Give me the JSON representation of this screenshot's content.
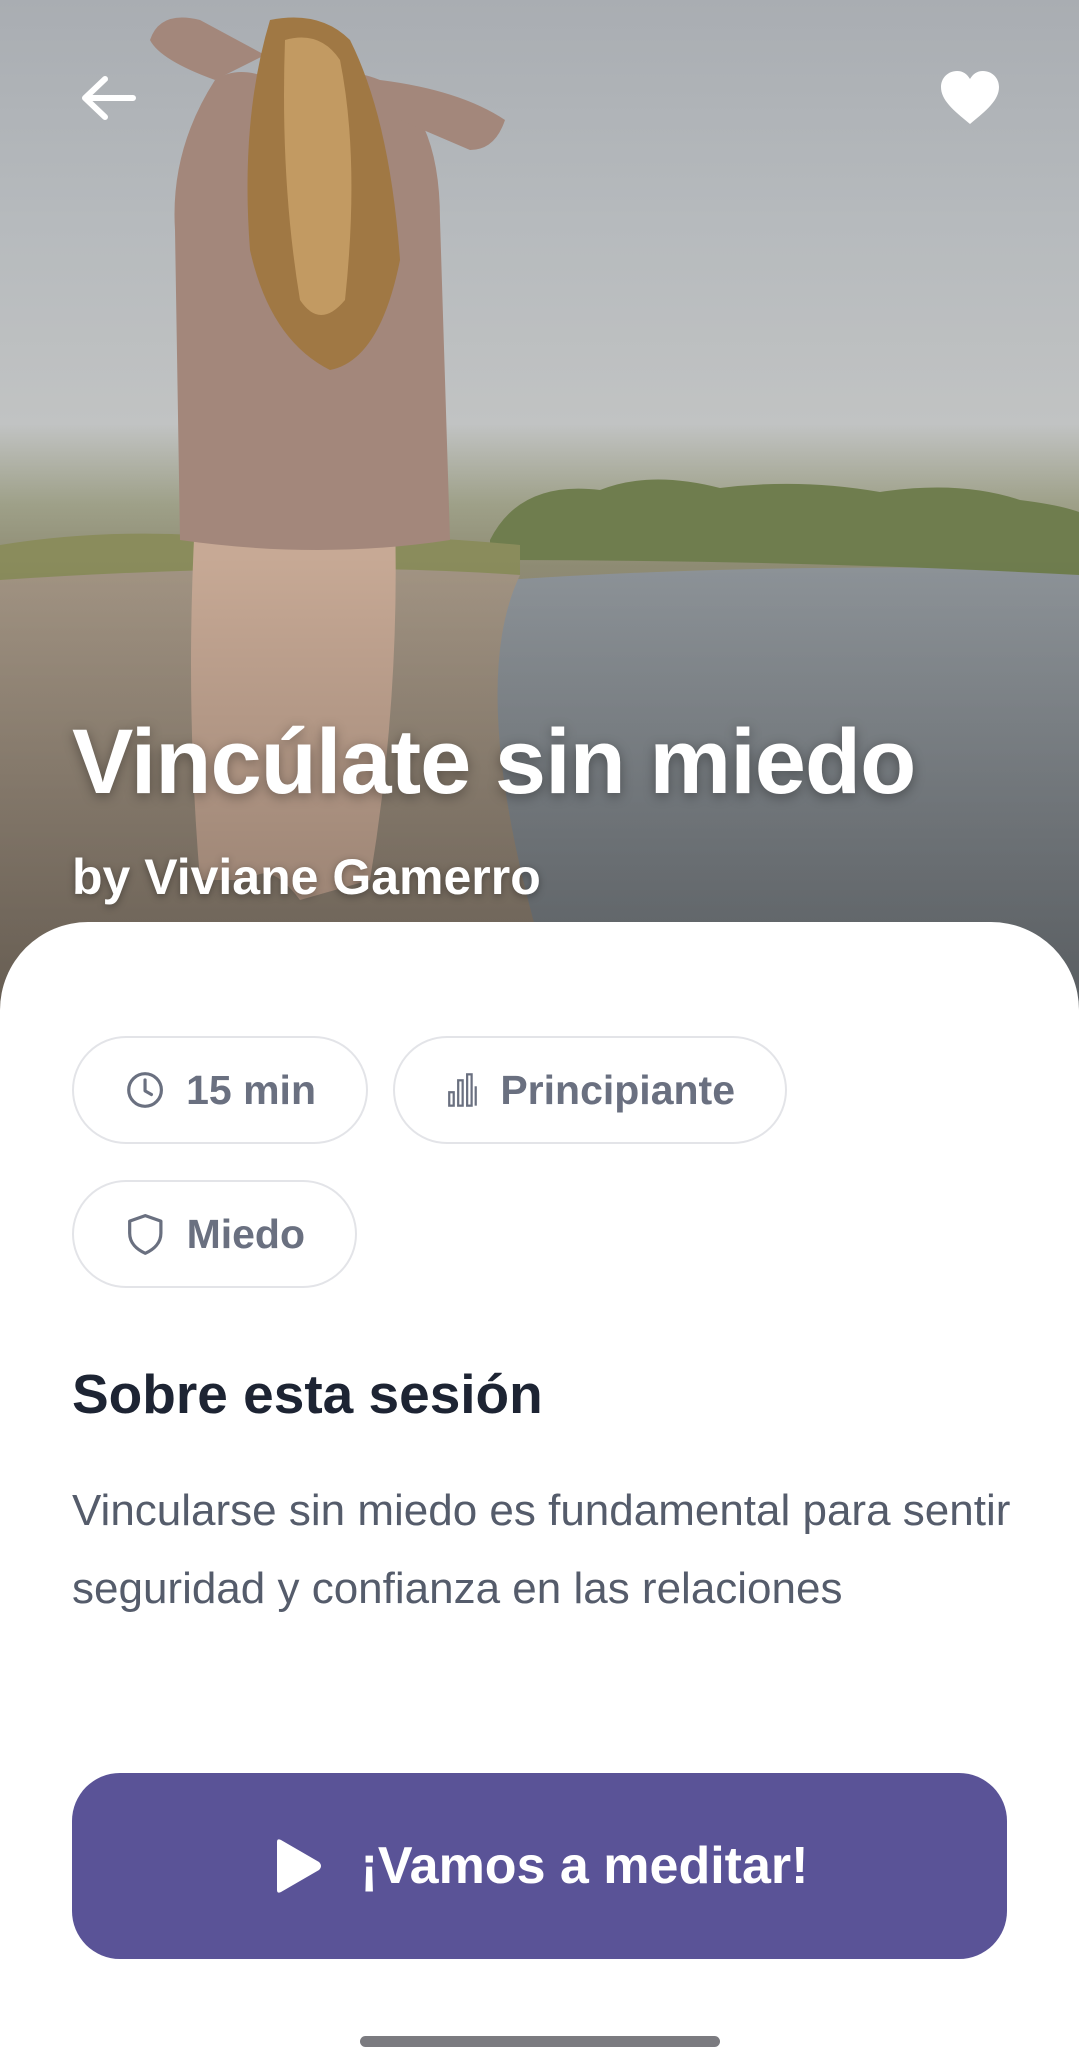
{
  "header": {
    "back_icon": "arrow-left-icon",
    "favorite_icon": "heart-icon"
  },
  "session": {
    "title": "Vincúlate sin miedo",
    "author": "by Viviane Gamerro"
  },
  "chips": {
    "duration": {
      "icon": "clock-icon",
      "label": "15 min"
    },
    "level": {
      "icon": "bar-chart-icon",
      "label": "Principiante"
    },
    "topic": {
      "icon": "shield-icon",
      "label": "Miedo"
    }
  },
  "about": {
    "heading": "Sobre esta sesión",
    "description": "Vincularse sin miedo es fundamental para sentir seguridad y confianza en las relaciones"
  },
  "cta": {
    "icon": "play-icon",
    "label": "¡Vamos a meditar!"
  },
  "colors": {
    "accent": "#5a5397",
    "chip_text": "#6a7080",
    "heading": "#1d2433",
    "body_text": "#555c6b"
  }
}
